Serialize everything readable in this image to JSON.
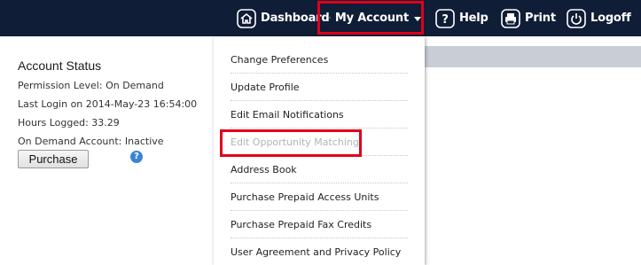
{
  "nav": {
    "dashboard": "Dashboard",
    "my_account": "My Account",
    "help": "Help",
    "print": "Print",
    "logoff": "Logoff"
  },
  "account_status": {
    "title": "Account Status",
    "permission_level": "Permission Level:  On Demand",
    "last_login": "Last Login on 2014-May-23 16:54:00",
    "hours_logged": "Hours Logged: 33.29",
    "on_demand_account": "On Demand Account: Inactive",
    "purchase_button": "Purchase",
    "help_icon_glyph": "?"
  },
  "menu": {
    "items": [
      {
        "label": "Change Preferences",
        "enabled": true
      },
      {
        "label": "Update Profile",
        "enabled": true
      },
      {
        "label": "Edit Email Notifications",
        "enabled": true
      },
      {
        "label": "Edit Opportunity Matching",
        "enabled": false
      },
      {
        "label": "Address Book",
        "enabled": true
      },
      {
        "label": "Purchase Prepaid Access Units",
        "enabled": true
      },
      {
        "label": "Purchase Prepaid Fax Credits",
        "enabled": true
      },
      {
        "label": "User Agreement and Privacy Policy",
        "enabled": true
      }
    ]
  },
  "colors": {
    "topbar": "#0f1d37",
    "highlight": "#e0001b",
    "disabled_text": "#b3b3b3"
  }
}
